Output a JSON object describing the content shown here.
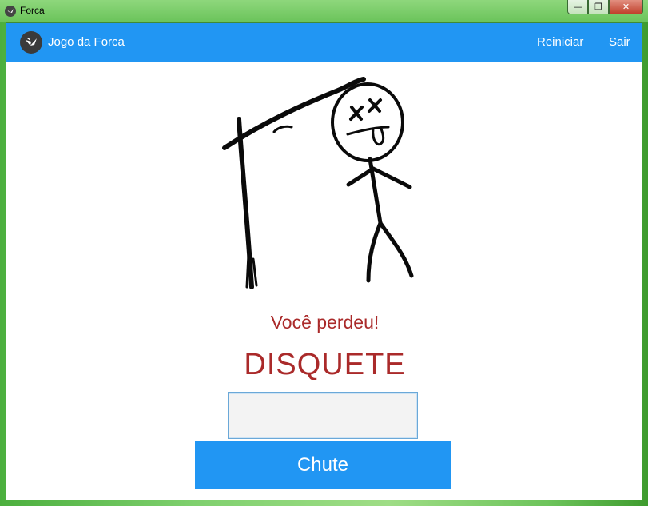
{
  "window": {
    "title": "Forca",
    "minimize_symbol": "—",
    "maximize_symbol": "❐",
    "close_symbol": "✕"
  },
  "appbar": {
    "title": "Jogo da Forca",
    "actions": [
      {
        "label": "Reiniciar"
      },
      {
        "label": "Sair"
      }
    ]
  },
  "game": {
    "status": "Você perdeu!",
    "word": "DISQUETE",
    "guess_value": "",
    "guess_button": "Chute"
  },
  "colors": {
    "accent": "#2196f3",
    "lose_text": "#aa2a2a"
  },
  "icons": {
    "app": "kivy-logo-icon"
  }
}
